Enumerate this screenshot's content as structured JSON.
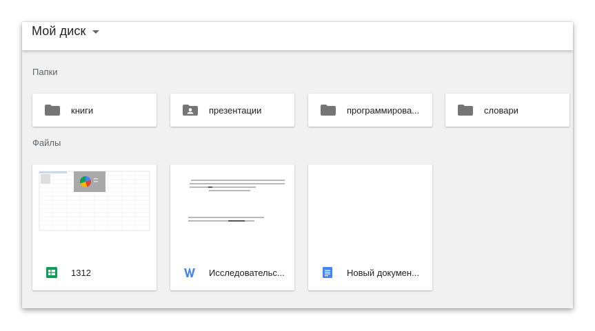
{
  "header": {
    "title": "Мой диск"
  },
  "sections": {
    "folders_label": "Папки",
    "files_label": "Файлы"
  },
  "folders": [
    {
      "name": "книги",
      "icon": "folder-icon"
    },
    {
      "name": "презентации",
      "icon": "shared-folder-icon"
    },
    {
      "name": "программирова...",
      "icon": "folder-icon"
    },
    {
      "name": "словари",
      "icon": "folder-icon"
    }
  ],
  "files": [
    {
      "name": "1312",
      "type": "spreadsheet",
      "icon": "sheets-icon",
      "icon_color": "#0f9d58"
    },
    {
      "name": "Исследовательс...",
      "type": "word",
      "icon": "word-icon",
      "icon_color": "#4a86e8"
    },
    {
      "name": "Новый докумен...",
      "type": "document",
      "icon": "docs-icon",
      "icon_color": "#4285f4"
    }
  ],
  "colors": {
    "background": "#f1f1f1",
    "folder_icon": "#757575"
  }
}
